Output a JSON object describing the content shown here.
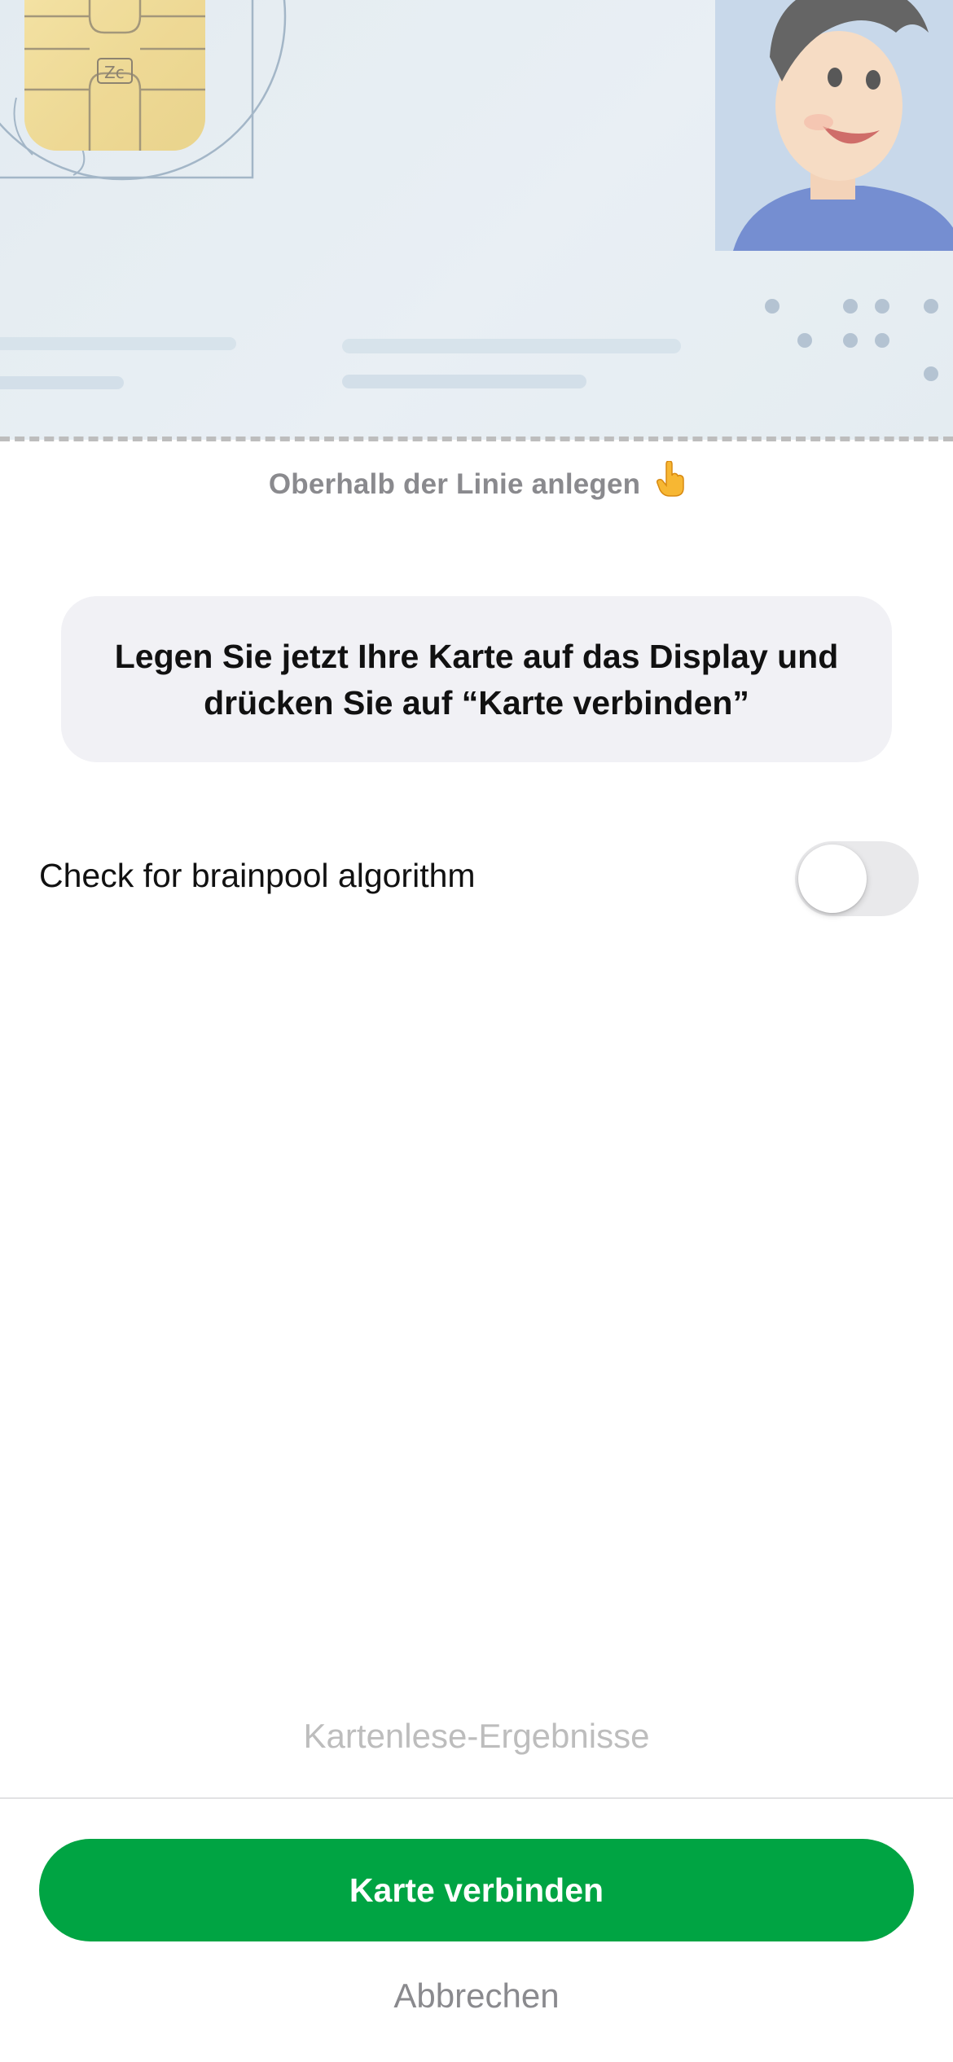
{
  "card": {
    "placement_hint": "Oberhalb der Linie anlegen",
    "hint_icon": "pointing-finger-icon"
  },
  "instruction": {
    "line1": "Legen Sie jetzt Ihre Karte auf das Display und",
    "line2": "drücken Sie auf “Karte verbinden”"
  },
  "settings": {
    "brainpool_label": "Check for brainpool algorithm",
    "brainpool_enabled": false
  },
  "results": {
    "label": "Kartenlese-Ergebnisse"
  },
  "actions": {
    "connect_label": "Karte verbinden",
    "cancel_label": "Abbrechen"
  },
  "colors": {
    "primary": "#00a443",
    "card_background": "#dfe8ef",
    "bubble_background": "#f1f1f5"
  }
}
